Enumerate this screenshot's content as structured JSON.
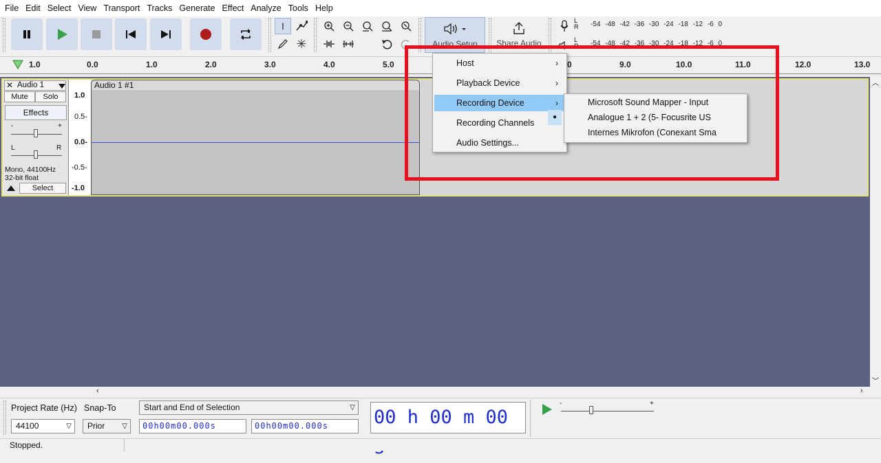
{
  "menubar": {
    "items": [
      "File",
      "Edit",
      "Select",
      "View",
      "Transport",
      "Tracks",
      "Generate",
      "Effect",
      "Analyze",
      "Tools",
      "Help"
    ]
  },
  "toolbar": {
    "transport": [
      "pause-icon",
      "play-icon",
      "stop-icon",
      "skip-start-icon",
      "skip-end-icon",
      "record-icon",
      "loop-icon"
    ],
    "audio_setup_label": "Audio Setup",
    "share_audio_label": "Share Audio",
    "meter_scale": "-54 -48 -42 -36 -30 -24 -18 -12 -6 0",
    "meter_lr_top": "L R",
    "meter_lr_bottom": "L R"
  },
  "ruler": {
    "left_label": "1.0",
    "ticks": [
      "0.0",
      "1.0",
      "2.0",
      "3.0",
      "4.0",
      "5.0",
      "9.0",
      "10.0",
      "11.0",
      "12.0",
      "13.0"
    ],
    "partial_tick": "0"
  },
  "track": {
    "name": "Audio 1",
    "clip_name": "Audio 1 #1",
    "mute_label": "Mute",
    "solo_label": "Solo",
    "effects_label": "Effects",
    "gain_minus": "-",
    "gain_plus": "+",
    "pan_left": "L",
    "pan_right": "R",
    "format_line1": "Mono, 44100Hz",
    "format_line2": "32-bit float",
    "select_label": "Select",
    "scale": [
      "1.0",
      "0.5-",
      "0.0-",
      "-0.5-",
      "-1.0"
    ]
  },
  "audio_setup_menu": {
    "items": [
      {
        "label": "Host",
        "submenu": true
      },
      {
        "label": "Playback Device",
        "submenu": true
      },
      {
        "label": "Recording Device",
        "submenu": true,
        "highlighted": true
      },
      {
        "label": "Recording Channels",
        "submenu": true
      },
      {
        "label": "Audio Settings...",
        "submenu": false
      }
    ]
  },
  "recording_device_submenu": {
    "items": [
      {
        "label": "Microsoft Sound Mapper - Input",
        "selected": false
      },
      {
        "label": "Analogue 1 + 2 (5- Focusrite US",
        "selected": true
      },
      {
        "label": "Internes Mikrofon (Conexant Sma",
        "selected": false
      }
    ]
  },
  "selection_bar": {
    "project_rate_label": "Project Rate (Hz)",
    "project_rate_value": "44100",
    "snap_to_label": "Snap-To",
    "snap_to_value": "Prior",
    "selection_mode": "Start and End of Selection",
    "start_time": "00h00m00.000s",
    "end_time": "00h00m00.000s",
    "big_time": "00 h 00 m 00 s",
    "play_speed_minus": "-",
    "play_speed_plus": "+"
  },
  "status": {
    "text": "Stopped."
  },
  "colors": {
    "highlight": "#91c9f7",
    "annotation_box": "#e8101c",
    "track_background": "#5e6080",
    "waveform_line": "#3d4ed8",
    "record_button": "#b01b1b",
    "play_button": "#36a04a"
  }
}
